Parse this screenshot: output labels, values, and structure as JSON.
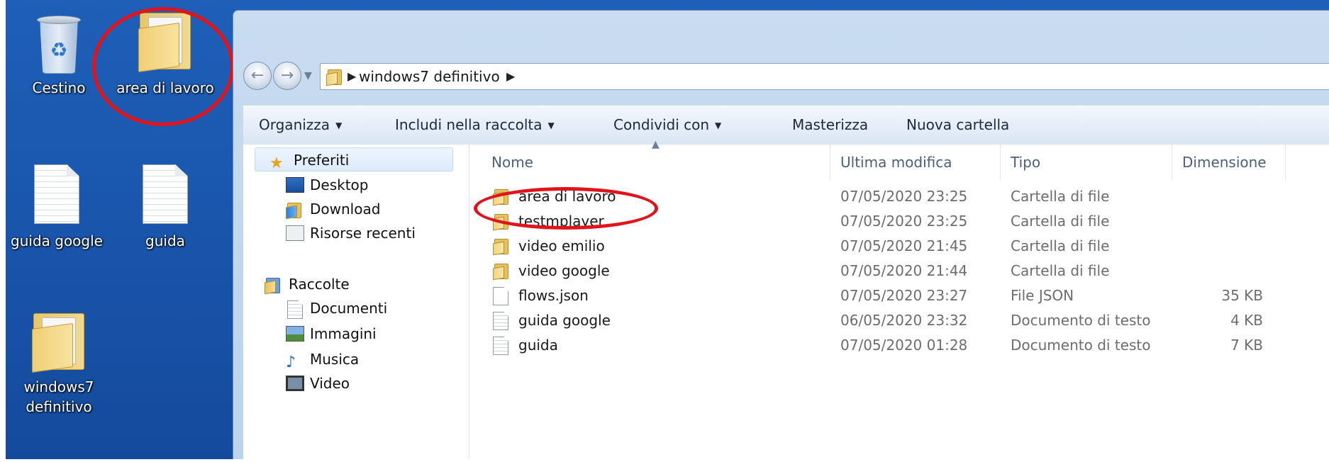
{
  "desktop": {
    "icons": [
      {
        "label": "Cestino"
      },
      {
        "label": "area di lavoro"
      },
      {
        "label": "guida google"
      },
      {
        "label": "guida"
      },
      {
        "label": "windows7 definitivo"
      }
    ]
  },
  "address_bar": {
    "crumb": "windows7 definitivo"
  },
  "toolbar": {
    "organize": "Organizza",
    "include": "Includi nella raccolta",
    "share": "Condividi con",
    "burn": "Masterizza",
    "new_folder": "Nuova cartella"
  },
  "navigation": {
    "favorites": "Preferiti",
    "desktop": "Desktop",
    "download": "Download",
    "recent": "Risorse recenti",
    "libraries": "Raccolte",
    "documents": "Documenti",
    "images": "Immagini",
    "music": "Musica",
    "video": "Video"
  },
  "columns": {
    "name": "Nome",
    "modified": "Ultima modifica",
    "type": "Tipo",
    "size": "Dimensione"
  },
  "files": [
    {
      "name": "area di lavoro",
      "modified": "07/05/2020 23:25",
      "type": "Cartella di file",
      "size": "",
      "icon": "folder-icon"
    },
    {
      "name": "testmplayer",
      "modified": "07/05/2020 23:25",
      "type": "Cartella di file",
      "size": "",
      "icon": "folder-icon"
    },
    {
      "name": "video emilio",
      "modified": "07/05/2020 21:45",
      "type": "Cartella di file",
      "size": "",
      "icon": "folder-icon"
    },
    {
      "name": "video google",
      "modified": "07/05/2020 21:44",
      "type": "Cartella di file",
      "size": "",
      "icon": "folder-icon"
    },
    {
      "name": "flows.json",
      "modified": "07/05/2020 23:27",
      "type": "File JSON",
      "size": "35 KB",
      "icon": "file-icon"
    },
    {
      "name": "guida google",
      "modified": "06/05/2020 23:32",
      "type": "Documento di testo",
      "size": "4 KB",
      "icon": "text-file-icon"
    },
    {
      "name": "guida",
      "modified": "07/05/2020 01:28",
      "type": "Documento di testo",
      "size": "7 KB",
      "icon": "text-file-icon"
    }
  ],
  "colors": {
    "desktop_blue": "#1a56ad",
    "annotation_red": "#e0151b"
  }
}
